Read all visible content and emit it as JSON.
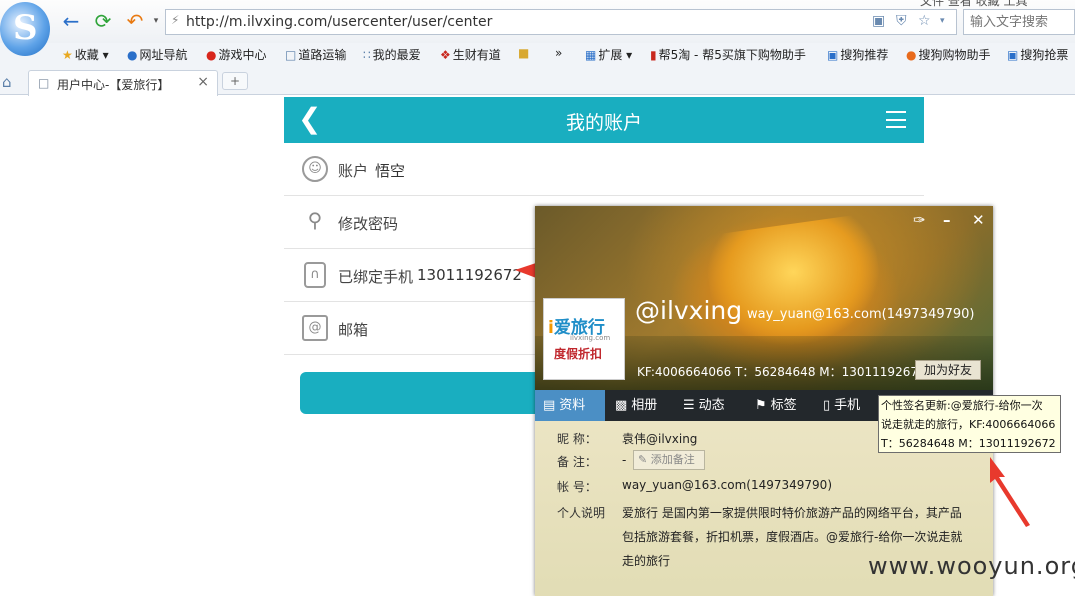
{
  "browser": {
    "url": "http://m.ilvxing.com/usercenter/user/center",
    "search_placeholder": "输入文字搜索",
    "top_menu": "文件  查看  收藏  工具",
    "bookmarks": [
      "收藏",
      "网址导航",
      "游戏中心",
      "道路运输",
      "我的最爱",
      "生财有道",
      "»",
      "扩展",
      "帮5淘 - 帮5买旗下购物助手",
      "搜狗推荐",
      "搜狗购物助手",
      "搜狗抢票"
    ],
    "tab_title": "用户中心-【爱旅行】",
    "new_tab": "+"
  },
  "page": {
    "header_title": "我的账户",
    "rows": [
      {
        "label": "账户",
        "value": "悟空"
      },
      {
        "label": "修改密码",
        "value": ""
      },
      {
        "label": "已绑定手机",
        "value": "13011192672"
      },
      {
        "label": "邮箱",
        "value": ""
      }
    ]
  },
  "card": {
    "nickname_display": "@ilvxing",
    "email_display": "way_yuan@163.com(1497349790)",
    "contact_line": "KF:4006664066 T：56284648 M：13011192672",
    "add_friend": "加为好友",
    "avatar": {
      "brand": "爱旅行",
      "url": "ilvxing.com",
      "slogan": "度假折扣"
    },
    "tabs": [
      "资料",
      "相册",
      "动态",
      "标签",
      "手机"
    ],
    "fields": {
      "nick_label": "昵    称：",
      "nick_value": "袁伟@ilvxing",
      "note_label": "备    注：",
      "note_value": "-",
      "note_button": "添加备注",
      "account_label": "帐    号：",
      "account_value": "way_yuan@163.com(1497349790)",
      "intro_label": "个人说明",
      "intro_value": "爱旅行 是国内第一家提供限时特价旅游产品的网络平台，其产品包括旅游套餐，折扣机票，度假酒店。@爱旅行-给你一次说走就走的旅行"
    }
  },
  "tooltip": {
    "line1": "个性签名更新:@爱旅行-给你一次",
    "line2": "说走就走的旅行，KF:4006664066",
    "line3": "T：56284648 M：13011192672"
  },
  "watermark": "www.wooyun.org",
  "colors": {
    "accent": "#19aec0",
    "arrow": "#e8392d",
    "tab_active": "#4b8fc5"
  }
}
